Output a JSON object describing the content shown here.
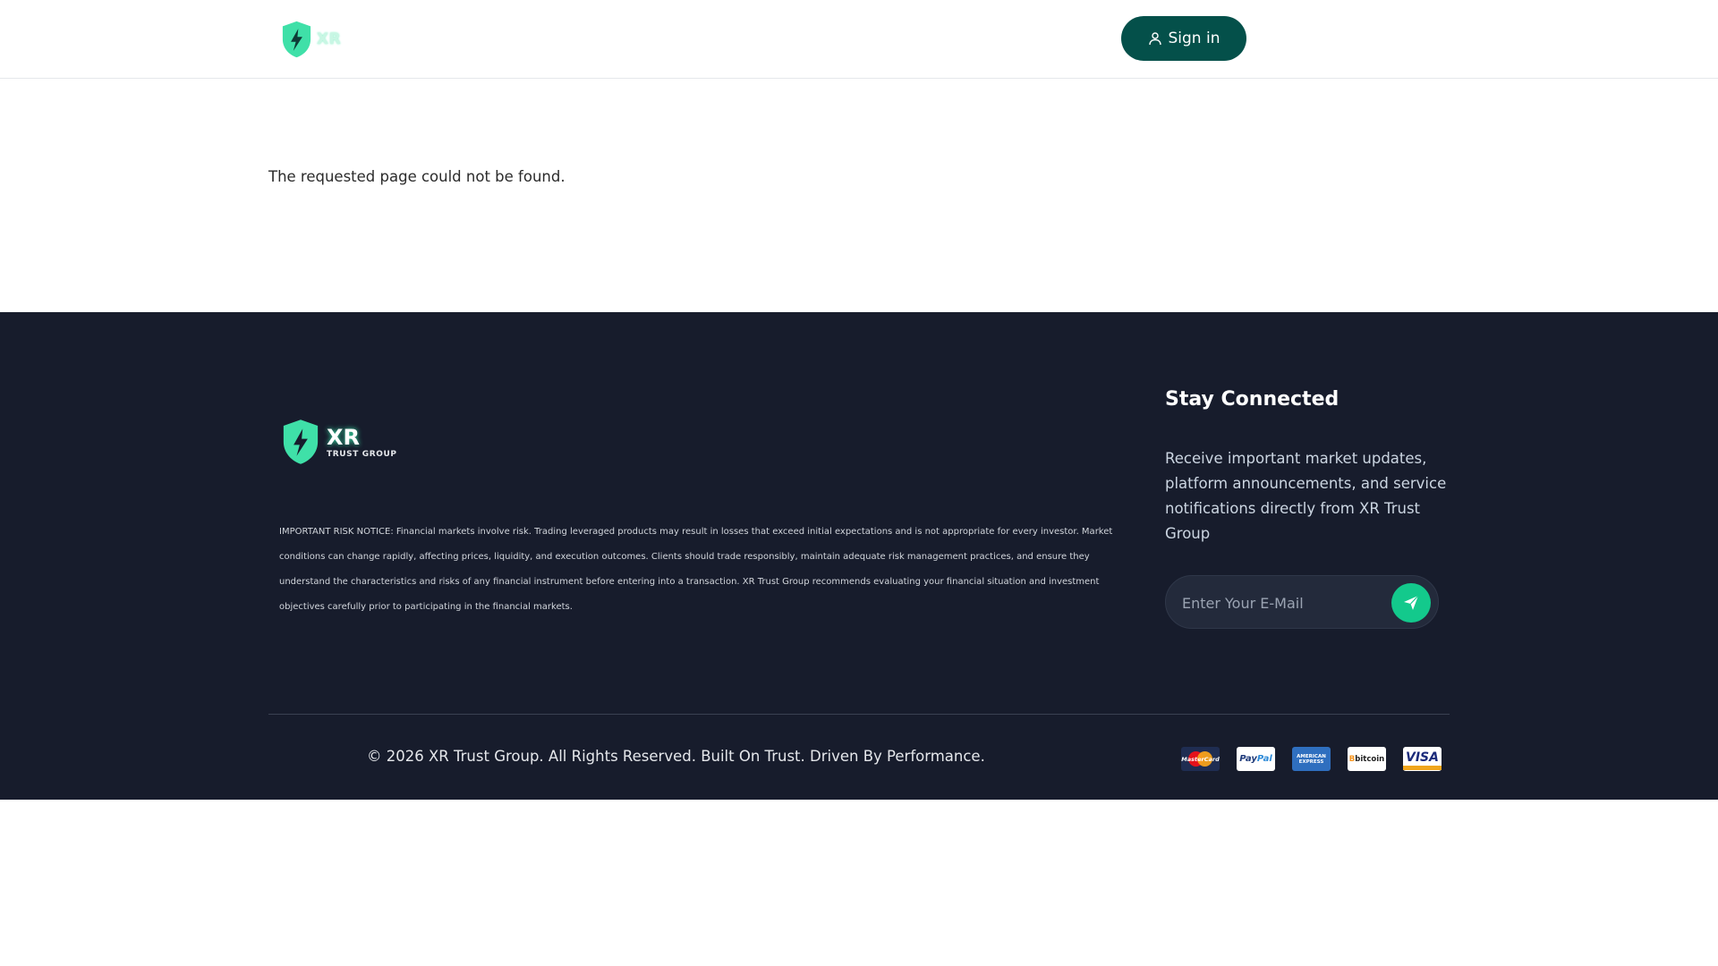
{
  "header": {
    "logo_text": "XR",
    "signin_label": "Sign in"
  },
  "main": {
    "message": "The requested page could not be found."
  },
  "footer": {
    "brand_name": "XR",
    "brand_sub": "TRUST GROUP",
    "risk_notice": "IMPORTANT RISK NOTICE: Financial markets involve risk. Trading leveraged products may result in losses that exceed initial expectations and is not appropriate for every investor. Market conditions can change rapidly, affecting prices, liquidity, and execution outcomes. Clients should trade responsibly, maintain adequate risk management practices, and ensure they understand the characteristics and risks of any financial instrument before entering into a transaction. XR Trust Group recommends evaluating your financial situation and investment objectives carefully prior to participating in the financial markets.",
    "stay_title": "Stay Connected",
    "stay_desc": "Receive important market updates, platform announcements, and service notifications directly from XR Trust Group",
    "email_placeholder": "Enter Your E-Mail",
    "copyright": "© 2026 XR Trust Group. All Rights Reserved. Built On Trust. Driven By Performance.",
    "payments": {
      "mastercard": "MasterCard",
      "paypal_a": "Pay",
      "paypal_b": "Pal",
      "amex_a": "AMERICAN",
      "amex_b": "EXPRESS",
      "bitcoin_symbol": "B",
      "bitcoin": "bitcoin",
      "visa": "VISA"
    }
  },
  "colors": {
    "accent": "#13c98c",
    "signin_bg": "#04504a",
    "footer_bg": "#171c2c"
  }
}
